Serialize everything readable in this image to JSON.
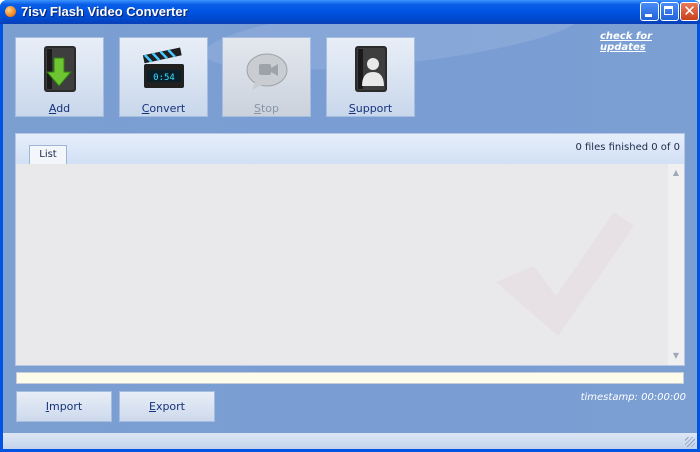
{
  "window": {
    "title": "7isv Flash Video Converter"
  },
  "header": {
    "check_updates": "check for updates"
  },
  "toolbar": {
    "add": {
      "label": "Add",
      "mnemonic": "A",
      "rest": "dd",
      "icon": "add-icon"
    },
    "convert": {
      "label": "Convert",
      "mnemonic": "C",
      "rest": "onvert",
      "icon": "clapperboard-icon",
      "clock_text": "0:54"
    },
    "stop": {
      "label": "Stop",
      "mnemonic": "S",
      "rest": "top",
      "icon": "stop-icon"
    },
    "support": {
      "label": "Support",
      "mnemonic": "S",
      "rest": "upport",
      "icon": "support-icon"
    }
  },
  "list": {
    "tab_label": "List",
    "status": "0 files finished 0 of 0"
  },
  "progress": {
    "value": 0
  },
  "bottom": {
    "import": {
      "label": "Import",
      "mnemonic": "I",
      "rest": "mport"
    },
    "export": {
      "label": "Export",
      "mnemonic": "E",
      "rest": "xport"
    },
    "timestamp": "timestamp: 00:00:00"
  },
  "colors": {
    "accent": "#0054e3",
    "client_bg": "#7b9fd3",
    "label_text": "#15337a"
  }
}
